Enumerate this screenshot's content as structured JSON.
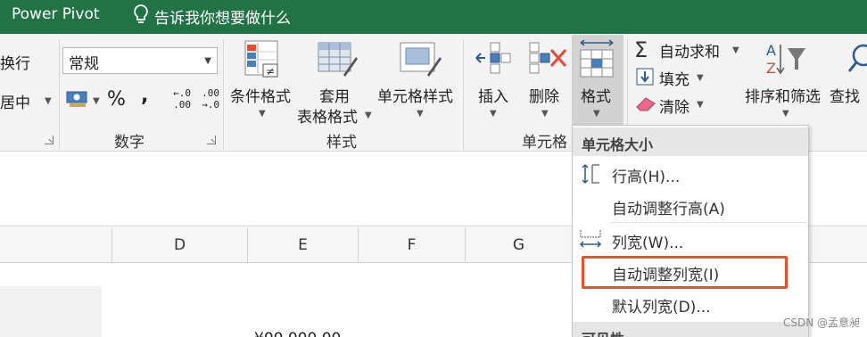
{
  "titlebar": {
    "app_name": "Power Pivot",
    "tell_me": "告诉我你想要做什么"
  },
  "ribbon": {
    "alignment": {
      "wrap_partial": "换行",
      "merge_partial": "居中"
    },
    "number": {
      "format_value": "常规",
      "percent": "%",
      "comma": ",",
      "dec_inc_top": "←.0",
      "dec_inc_bottom": ".00",
      "dec_dec_top": ".00",
      "dec_dec_bottom": "→.0",
      "group_label": "数字"
    },
    "styles": {
      "conditional": "条件格式",
      "table_line1": "套用",
      "table_line2": "表格格式",
      "cell_styles": "单元格样式",
      "group_label": "样式"
    },
    "cells": {
      "insert": "插入",
      "delete": "删除",
      "format": "格式",
      "group_label_partial": "单元格"
    },
    "editing": {
      "autosum": "自动求和",
      "fill": "填充",
      "clear": "清除",
      "sort_filter": "排序和筛选",
      "find_partial": "查找"
    }
  },
  "columns": [
    "D",
    "E",
    "F",
    "G"
  ],
  "grid": {
    "partial_value": "¥00,000.00"
  },
  "menu": {
    "section1": "单元格大小",
    "items": [
      {
        "label": "行高(H)..."
      },
      {
        "label": "自动调整行高(A)"
      },
      {
        "label": "列宽(W)..."
      },
      {
        "label": "自动调整列宽(I)"
      },
      {
        "label": "默认列宽(D)..."
      }
    ],
    "section2_partial": "可见性"
  },
  "colors": {
    "title_bg": "#217346",
    "highlight": "#e8512b"
  },
  "watermark": "CSDN @孟意昶"
}
